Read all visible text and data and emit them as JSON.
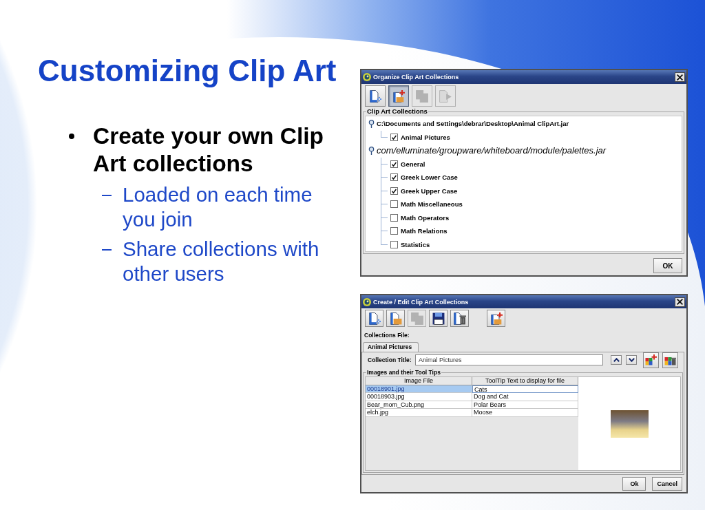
{
  "slide": {
    "title": "Customizing Clip Art",
    "bullets": [
      {
        "text": "Create your own Clip Art collections",
        "children": [
          {
            "text": "Loaded on each time you join"
          },
          {
            "text": "Share collections with other users"
          }
        ]
      }
    ]
  },
  "organize_dialog": {
    "title": "Organize Clip Art Collections",
    "toolbar_groups": [
      [
        {
          "kind": "import",
          "pressed": false,
          "disabled": false
        },
        {
          "kind": "add",
          "pressed": true,
          "disabled": false
        },
        {
          "kind": "copy",
          "pressed": false,
          "disabled": true
        },
        {
          "kind": "move",
          "pressed": false,
          "disabled": true
        }
      ]
    ],
    "group_title": "Clip Art Collections",
    "tree": [
      {
        "kind": "file",
        "label": "C:\\Documents and Settings\\debrar\\Desktop\\Animal ClipArt.jar",
        "expanded": true,
        "children": [
          {
            "label": "Animal Pictures",
            "checked": true
          }
        ]
      },
      {
        "kind": "package",
        "label": "com/elluminate/groupware/whiteboard/module/palettes.jar",
        "expanded": true,
        "children": [
          {
            "label": "General",
            "checked": true
          },
          {
            "label": "Greek Lower Case",
            "checked": true
          },
          {
            "label": "Greek Upper Case",
            "checked": true
          },
          {
            "label": "Math Miscellaneous",
            "checked": false
          },
          {
            "label": "Math Operators",
            "checked": false
          },
          {
            "label": "Math Relations",
            "checked": false
          },
          {
            "label": "Statistics",
            "checked": false
          }
        ]
      }
    ],
    "buttons": [
      "OK"
    ]
  },
  "edit_dialog": {
    "title": "Create / Edit Clip Art Collections",
    "toolbar_groups": [
      [
        {
          "kind": "import",
          "pressed": false,
          "disabled": false
        },
        {
          "kind": "open",
          "pressed": false,
          "disabled": false
        },
        {
          "kind": "copy",
          "pressed": false,
          "disabled": true
        },
        {
          "kind": "save",
          "pressed": false,
          "disabled": false
        },
        {
          "kind": "delete",
          "pressed": false,
          "disabled": false
        }
      ],
      [
        {
          "kind": "add",
          "pressed": false,
          "disabled": false
        }
      ]
    ],
    "file_label": "Collections File:",
    "tabs": [
      {
        "label": "Animal Pictures",
        "selected": true
      }
    ],
    "title_field": {
      "label": "Collection Title:",
      "value": "Animal Pictures"
    },
    "side_buttons": [
      {
        "kind": "up"
      },
      {
        "kind": "down"
      },
      {
        "kind": "image-add"
      },
      {
        "kind": "image-delete"
      }
    ],
    "group_title": "Images and their Tool Tips",
    "table": {
      "columns": [
        "Image File",
        "ToolTip Text to display for file"
      ],
      "rows": [
        {
          "cells": [
            "00018901.jpg",
            "Cats"
          ],
          "selected": true
        },
        {
          "cells": [
            "00018903.jpg",
            "Dog and Cat"
          ],
          "selected": false
        },
        {
          "cells": [
            "Bear_mom_Cub.png",
            "Polar Bears"
          ],
          "selected": false
        },
        {
          "cells": [
            "elch.jpg",
            "Moose"
          ],
          "selected": false
        }
      ]
    },
    "buttons": [
      "Ok",
      "Cancel"
    ]
  }
}
